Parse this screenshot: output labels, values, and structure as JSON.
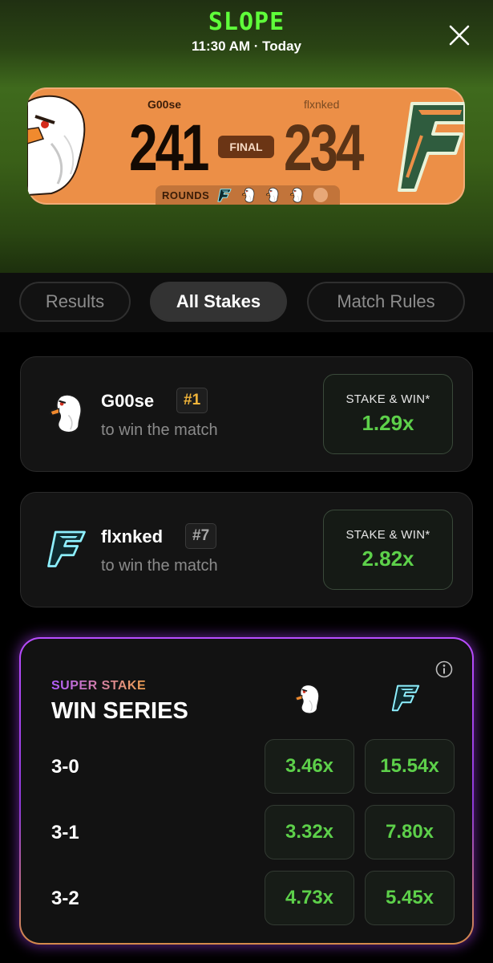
{
  "header": {
    "app_title": "SLOPE",
    "subtitle": "11:30 AM · Today",
    "close_icon": "close-icon"
  },
  "scoreboard": {
    "player1": {
      "name": "G00se",
      "score": "241",
      "logo": "goose-logo-icon"
    },
    "player2": {
      "name": "flxnked",
      "score": "234",
      "logo": "f-logo-icon"
    },
    "status": "FINAL",
    "rounds_label": "ROUNDS",
    "rounds": [
      "f-logo-icon",
      "goose-logo-icon",
      "goose-logo-icon",
      "goose-logo-icon",
      "empty"
    ],
    "colors": {
      "card": "#ec8f47",
      "badge": "#6b3515"
    }
  },
  "tabs": [
    {
      "label": "Results",
      "active": false
    },
    {
      "label": "All Stakes",
      "active": true
    },
    {
      "label": "Match Rules",
      "active": false
    }
  ],
  "stakes": [
    {
      "player": "G00se",
      "rank": "#1",
      "subtitle": "to win the match",
      "button_label": "STAKE & WIN*",
      "multiplier": "1.29x",
      "icon": "goose-logo-icon"
    },
    {
      "player": "flxnked",
      "rank": "#7",
      "subtitle": "to win the match",
      "button_label": "STAKE & WIN*",
      "multiplier": "2.82x",
      "icon": "f-logo-icon"
    }
  ],
  "super_stake": {
    "label": "SUPER STAKE",
    "title": "WIN SERIES",
    "info_icon": "info-icon",
    "columns": [
      "goose-logo-icon",
      "f-logo-icon"
    ],
    "rows": [
      {
        "score": "3-0",
        "values": [
          "3.46x",
          "15.54x"
        ]
      },
      {
        "score": "3-1",
        "values": [
          "3.32x",
          "7.80x"
        ]
      },
      {
        "score": "3-2",
        "values": [
          "4.73x",
          "5.45x"
        ]
      }
    ]
  },
  "colors": {
    "accent_green": "#5dd04a",
    "title_green": "#5fff3a",
    "rank_gold": "#f0b43a",
    "super_border": "#b94dff"
  }
}
